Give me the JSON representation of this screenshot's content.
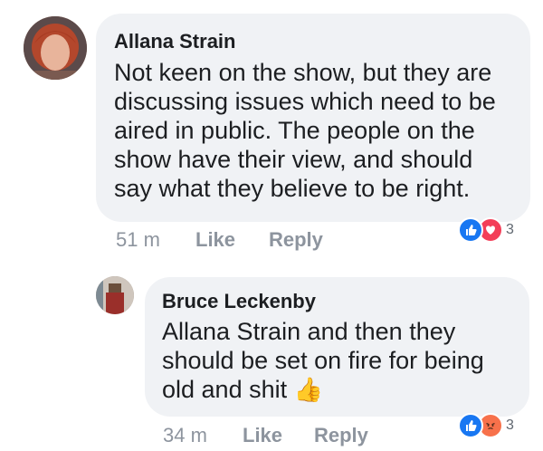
{
  "comments": [
    {
      "author": "Allana Strain",
      "text": "Not keen on the show, but they are discussing issues which need to be aired in public. The people on the show have their view, and should say what they believe to be right.",
      "time": "51 m",
      "like_label": "Like",
      "reply_label": "Reply",
      "reactions": {
        "icons": [
          "like-icon",
          "love-icon"
        ],
        "count": "3"
      }
    },
    {
      "author": "Bruce Leckenby",
      "text": "Allana Strain and then they should be set on fire for being old and shit",
      "emoji": "👍",
      "time": "34 m",
      "like_label": "Like",
      "reply_label": "Reply",
      "reactions": {
        "icons": [
          "like-icon",
          "angry-icon"
        ],
        "count": "3"
      }
    }
  ],
  "colors": {
    "bubble": "#f0f2f5",
    "meta": "#8d949e",
    "like": "#1877f2",
    "love": "#f33e58",
    "angry": "#f7714b"
  }
}
